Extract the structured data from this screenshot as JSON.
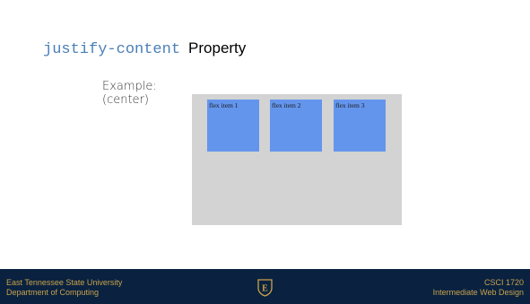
{
  "slide": {
    "title_code": "justify-content",
    "title_text": "Property",
    "example_label": "Example:",
    "example_value": "(center)"
  },
  "demo": {
    "items": [
      {
        "label": "flex item 1"
      },
      {
        "label": "flex item 2"
      },
      {
        "label": "flex item 3"
      }
    ],
    "container_color": "#d3d3d3",
    "item_color": "#6495ed"
  },
  "footer": {
    "left_line1": "East Tennessee State University",
    "left_line2": "Department of Computing",
    "right_line1": "CSCI 1720",
    "right_line2": "Intermediate Web Design",
    "logo_icon": "etsu-shield-icon",
    "logo_letter": "E",
    "background_color": "#0a2240",
    "text_color": "#c9a24a"
  }
}
